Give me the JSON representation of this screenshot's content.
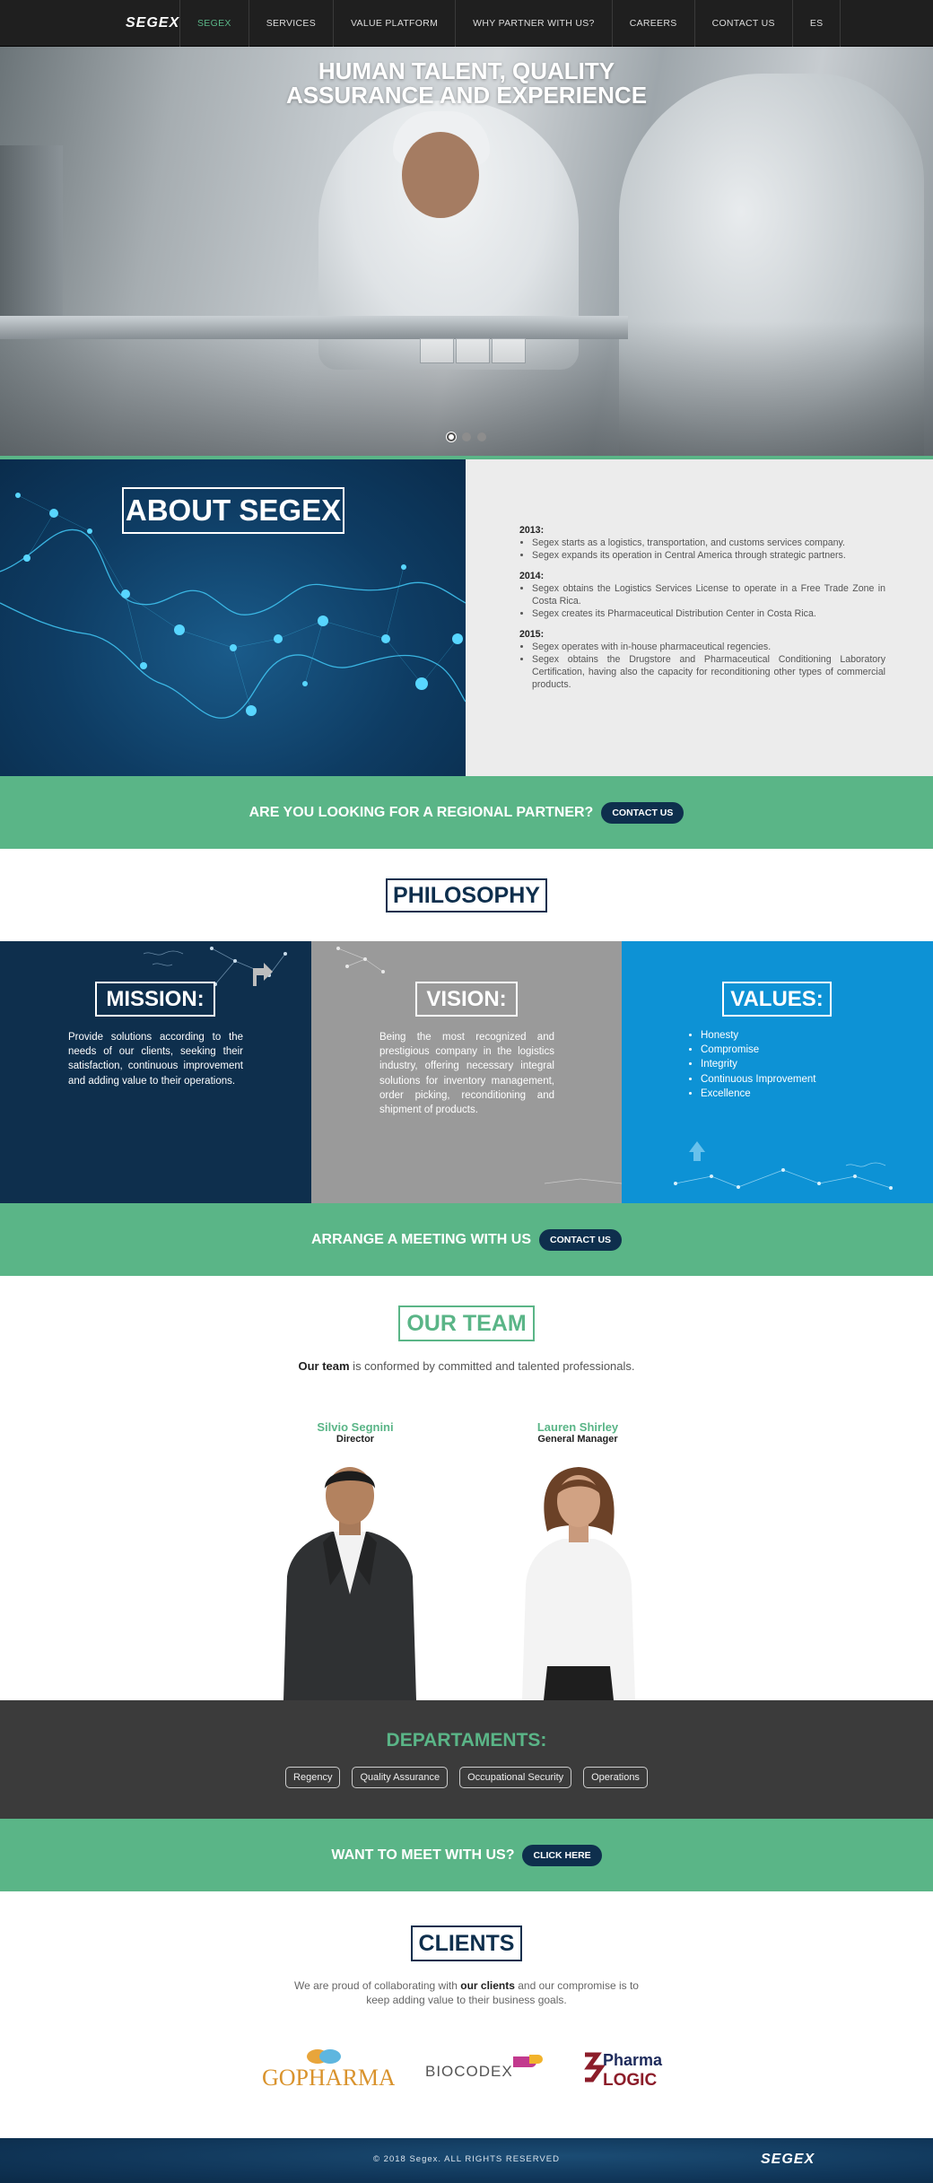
{
  "nav": {
    "logo": "SEGEX",
    "items": [
      "SEGEX",
      "SERVICES",
      "VALUE PLATFORM",
      "WHY PARTNER WITH US?",
      "CAREERS",
      "CONTACT US",
      "ES"
    ],
    "active_index": 0
  },
  "hero": {
    "title_line1": "HUMAN TALENT, QUALITY",
    "title_line2": "ASSURANCE AND EXPERIENCE",
    "slide_count": 3,
    "active_slide": 1
  },
  "about": {
    "title": "ABOUT SEGEX",
    "timeline": [
      {
        "year": "2013:",
        "items": [
          "Segex starts as a logistics, transportation, and customs services company.",
          "Segex expands its operation in Central America through strategic partners."
        ]
      },
      {
        "year": "2014:",
        "items": [
          "Segex obtains the Logistics Services License to operate in a Free Trade Zone in Costa Rica.",
          "Segex creates its Pharmaceutical Distribution Center in Costa Rica."
        ]
      },
      {
        "year": "2015:",
        "items": [
          "Segex operates with in-house pharmaceutical regencies.",
          "Segex obtains the Drugstore and Pharmaceutical Conditioning Laboratory Certification, having also the capacity for reconditioning other types of commercial products."
        ]
      }
    ]
  },
  "cta1": {
    "text": "ARE YOU LOOKING FOR A REGIONAL PARTNER?",
    "button": "CONTACT US"
  },
  "philosophy": {
    "title": "PHILOSOPHY",
    "mission": {
      "title": "MISSION:",
      "text": "Provide solutions according to the needs of our clients, seeking their satisfaction, continuous improvement and adding value to their operations."
    },
    "vision": {
      "title": "VISION:",
      "text": "Being the most recognized and prestigious company in the logistics industry, offering necessary integral solutions for inventory management, order picking, reconditioning and shipment of products."
    },
    "values": {
      "title": "VALUES:",
      "items": [
        "Honesty",
        "Compromise",
        "Integrity",
        "Continuous Improvement",
        "Excellence"
      ]
    }
  },
  "cta2": {
    "text": "ARRANGE A MEETING WITH US",
    "button": "CONTACT US"
  },
  "team": {
    "title": "OUR TEAM",
    "subtitle_bold": "Our team",
    "subtitle_rest": " is conformed by committed and talented professionals.",
    "members": [
      {
        "name": "Silvio Segnini",
        "role": "Director"
      },
      {
        "name": "Lauren Shirley",
        "role": "General Manager"
      }
    ]
  },
  "departments": {
    "title": "DEPARTAMENTS:",
    "tags": [
      "Regency",
      "Quality Assurance",
      "Occupational Security",
      "Operations"
    ]
  },
  "cta3": {
    "text": "WANT TO MEET WITH US?",
    "button": "CLICK HERE"
  },
  "clients": {
    "title": "CLIENTS",
    "sub_before": "We are proud of collaborating with ",
    "sub_bold": "our clients",
    "sub_after": " and our compromise is to keep adding value to their business goals.",
    "logos": [
      "GOPHARMA",
      "BIOCODEX",
      "Pharma",
      "LOGIC"
    ]
  },
  "footer": {
    "copyright": "© 2018 Segex. ALL RIGHTS RESERVED",
    "logo": "SEGEX"
  },
  "colors": {
    "green": "#5ab587",
    "navy": "#0e2f4d",
    "blue": "#0d92d5",
    "gray": "#9a9a9a",
    "dark": "#3b3b3b"
  }
}
